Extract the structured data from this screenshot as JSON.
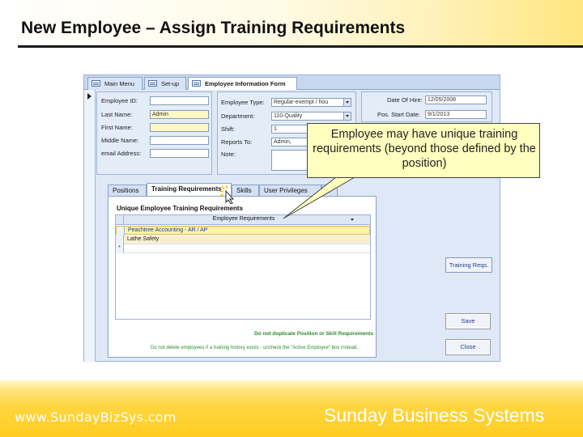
{
  "slide": {
    "title": "New Employee – Assign Training Requirements",
    "footer_left": "www.SundayBizSys.com",
    "footer_right": "Sunday Business Systems"
  },
  "app": {
    "doc_tabs": [
      {
        "label": "Main Menu",
        "active": false
      },
      {
        "label": "Set-up",
        "active": false
      },
      {
        "label": "Employee Information Form",
        "active": true
      }
    ],
    "left_fields": [
      {
        "label": "Employee ID:",
        "value": ""
      },
      {
        "label": "Last Name:",
        "value": "Admin"
      },
      {
        "label": "First Name:",
        "value": ""
      },
      {
        "label": "Middle Name:",
        "value": ""
      },
      {
        "label": "email Address:",
        "value": ""
      }
    ],
    "mid_fields": [
      {
        "label": "Employee Type:",
        "value": "Regular-exempt / hou"
      },
      {
        "label": "Department:",
        "value": "110-Quality"
      },
      {
        "label": "Shift:",
        "value": "1"
      },
      {
        "label": "Reports To:",
        "value": "Admin,"
      },
      {
        "label": "Note:",
        "value": ""
      }
    ],
    "date_fields": [
      {
        "label": "Date Of Hire:",
        "value": "12/05/2008"
      },
      {
        "label": "Pos. Start Date:",
        "value": "9/1/2013"
      }
    ],
    "sub_tabs": [
      "Positions",
      "Training Requirements",
      "Skills",
      "User Privileges",
      "L"
    ],
    "grid": {
      "title": "Unique Employee Training Requirements",
      "column_header": "Employee Requirements",
      "rows": [
        "Peachtree Accounting - AR / AP",
        "Lathe Safety",
        ""
      ],
      "new_row_marker": "*"
    },
    "note_green": "Do not duplicate Position or Skill Requirements",
    "note_bottom": "Do not delete employees if a training history exists - uncheck the \"Active Employee\" box instead.",
    "buttons": {
      "training_req": "Training Reqs.",
      "save": "Save",
      "close": "Close"
    }
  },
  "callout": {
    "text": "Employee may have unique training requirements (beyond those defined by the position)"
  },
  "colors": {
    "footer": "#ffd640",
    "callout_bg": "#ffffc0",
    "app_bg": "#dfe8f6"
  }
}
